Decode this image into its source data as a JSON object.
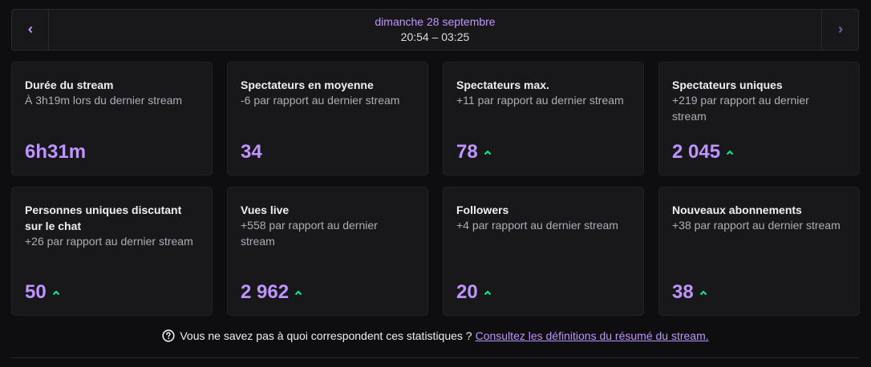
{
  "date_nav": {
    "date": "dimanche 28 septembre",
    "time_range": "20:54 – 03:25",
    "prev_icon": "chevron-left-icon",
    "next_icon": "chevron-right-icon"
  },
  "cards": [
    {
      "title": "Durée du stream",
      "sub": "À 3h19m lors du dernier stream",
      "value": "6h31m",
      "trend": ""
    },
    {
      "title": "Spectateurs en moyenne",
      "sub": "-6 par rapport au dernier stream",
      "value": "34",
      "trend": ""
    },
    {
      "title": "Spectateurs max.",
      "sub": "+11 par rapport au dernier stream",
      "value": "78",
      "trend": "up"
    },
    {
      "title": "Spectateurs uniques",
      "sub": "+219 par rapport au dernier stream",
      "value": "2 045",
      "trend": "up"
    },
    {
      "title": "Personnes uniques discutant sur le chat",
      "sub": "+26 par rapport au dernier stream",
      "value": "50",
      "trend": "up"
    },
    {
      "title": "Vues live",
      "sub": "+558 par rapport au dernier stream",
      "value": "2 962",
      "trend": "up"
    },
    {
      "title": "Followers",
      "sub": "+4 par rapport au dernier stream",
      "value": "20",
      "trend": "up"
    },
    {
      "title": "Nouveaux abonnements",
      "sub": "+38 par rapport au dernier stream",
      "value": "38",
      "trend": "up"
    }
  ],
  "footer": {
    "question": "Vous ne savez pas à quoi correspondent ces statistiques ?",
    "link": "Consultez les définitions du résumé du stream.",
    "help_icon": "question-circle-icon"
  },
  "colors": {
    "accent": "#bf94ff",
    "trend_up": "#00f593",
    "background": "#0e0e10",
    "card": "#18181b"
  }
}
